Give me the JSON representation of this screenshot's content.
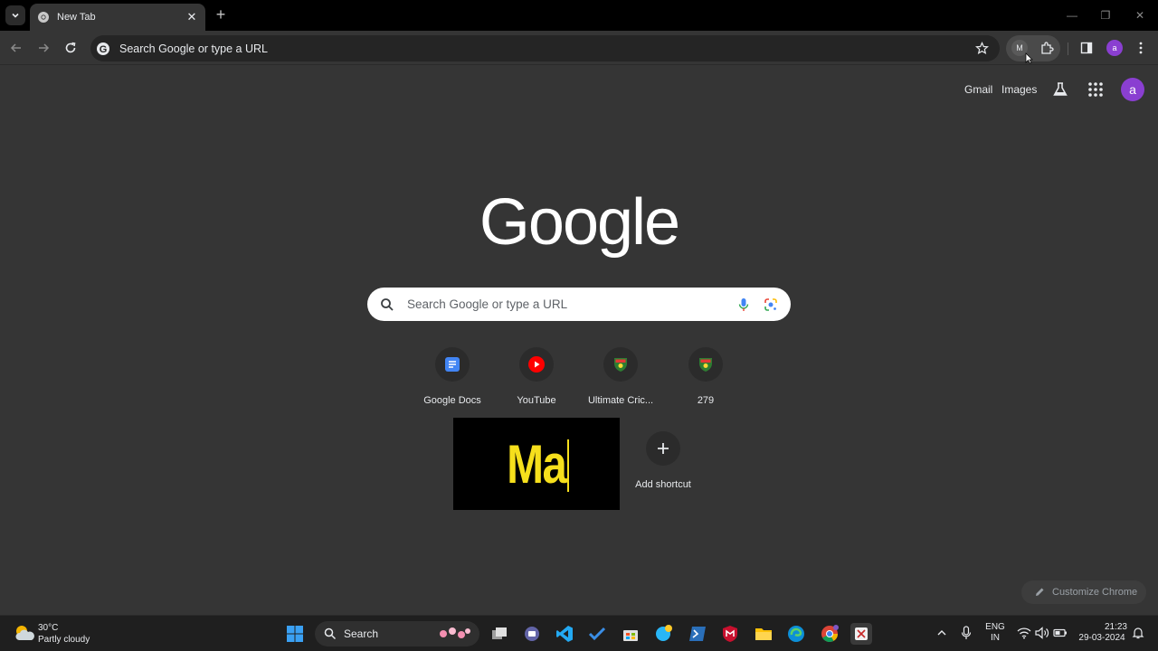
{
  "browser": {
    "tab_title": "New Tab",
    "omnibox_placeholder": "Search Google or type a URL",
    "extension_letter": "M",
    "profile_initial": "a"
  },
  "ntp": {
    "links": {
      "gmail": "Gmail",
      "images": "Images"
    },
    "logo": "Google",
    "search_placeholder": "Search Google or type a URL",
    "shortcuts": [
      {
        "label": "Google Docs",
        "icon": "docs-icon"
      },
      {
        "label": "YouTube",
        "icon": "youtube-icon"
      },
      {
        "label": "Ultimate Cric...",
        "icon": "cricket-crest-icon"
      },
      {
        "label": "279",
        "icon": "cricket-crest-icon"
      }
    ],
    "thumbnail_text": "Ma",
    "add_shortcut": "Add shortcut",
    "customize": "Customize Chrome"
  },
  "taskbar": {
    "weather_temp": "30°C",
    "weather_condition": "Partly cloudy",
    "search_label": "Search",
    "lang_line1": "ENG",
    "lang_line2": "IN",
    "time": "21:23",
    "date": "29-03-2024"
  },
  "colors": {
    "background": "#353535",
    "accent_avatar": "#8a3fd1",
    "thumbnail_text": "#f6df1c"
  }
}
